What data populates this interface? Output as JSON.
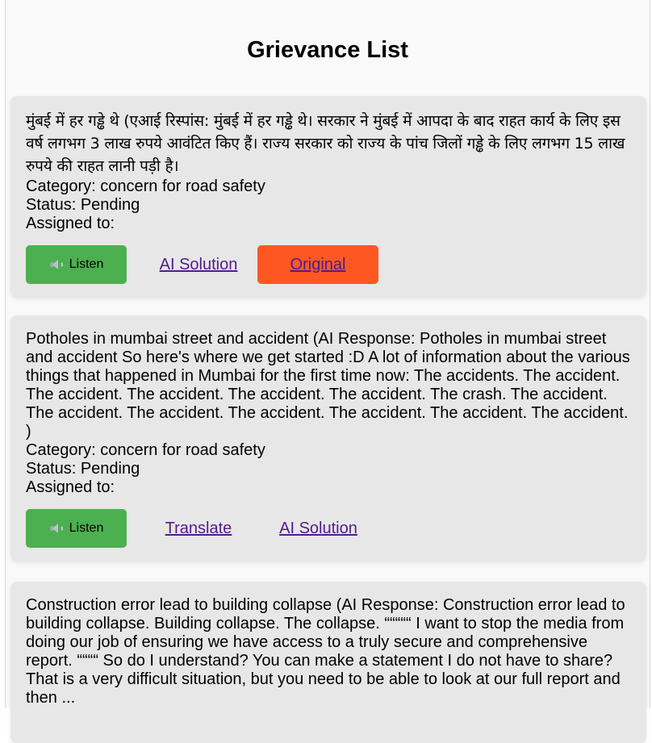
{
  "page": {
    "title": "Grievance List"
  },
  "labels": {
    "category_prefix": "Category: ",
    "status_prefix": "Status: ",
    "assigned_prefix": "Assigned to:"
  },
  "grievances": [
    {
      "text": "मुंबई में हर गड्ढे थे (एआई रिस्पांस: मुंबई में हर गड्ढे थे। सरकार ने मुंबई में आपदा के बाद राहत कार्य के लिए इस वर्ष लगभग 3 लाख रुपये आवंटित किए हैं। राज्य सरकार को राज्य के पांच जिलों गड्ढे के लिए लगभग 15 लाख रुपये की राहत लानी पड़ी है।",
      "category": "concern for road safety",
      "status": "Pending",
      "assigned_to": "",
      "buttons": {
        "listen": "Listen",
        "ai_solution": "AI Solution",
        "original": "Original"
      }
    },
    {
      "text": "Potholes in mumbai street and accident (AI Response: Potholes in mumbai street and accident So here's where we get started :D A lot of information about the various things that happened in Mumbai for the first time now: The accidents. The accident. The accident. The accident. The accident. The accident. The crash. The accident. The accident. The accident. The accident. The accident. The accident. The accident. )",
      "category": "concern for road safety",
      "status": "Pending",
      "assigned_to": "",
      "buttons": {
        "listen": "Listen",
        "translate": "Translate",
        "ai_solution": "AI Solution"
      }
    },
    {
      "text": "Construction error lead to building collapse (AI Response: Construction error lead to building collapse. Building collapse. The collapse. “““““ I want to stop the media from doing our job of ensuring we have access to a truly secure and comprehensive report. ““““ So do I understand? You can make a statement I do not have to share? That is a very difficult situation, but you need to be able to look at our full report and then ...",
      "category": "",
      "status": "",
      "assigned_to": ""
    }
  ],
  "colors": {
    "listen_button": "#4caf50",
    "original_button": "#ff5722",
    "card_background": "#e7e7e7",
    "link": "#551a8b"
  },
  "icons": {
    "listen": "speaker-icon"
  }
}
